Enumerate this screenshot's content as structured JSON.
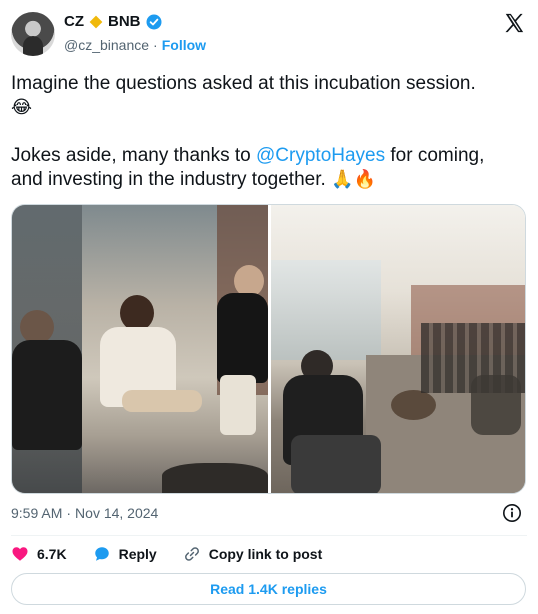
{
  "author": {
    "name": "CZ",
    "bnb_label": "BNB",
    "handle": "@cz_binance",
    "separator": "·",
    "follow_label": "Follow"
  },
  "tweet": {
    "line1": "Imagine the questions asked at this incubation session.",
    "line1_emoji": "😂",
    "line2_before": "Jokes aside, many thanks to ",
    "line2_mention": "@CryptoHayes",
    "line2_after": " for coming, and investing in the industry together. ",
    "line2_emoji": "🙏🔥"
  },
  "meta": {
    "time": "9:59 AM",
    "separator": "·",
    "date": "Nov 14, 2024"
  },
  "actions": {
    "likes": "6.7K",
    "reply_label": "Reply",
    "copy_label": "Copy link to post"
  },
  "read_replies_label": "Read 1.4K replies",
  "colors": {
    "accent": "#1d9bf0",
    "like": "#f91880",
    "bnb": "#f0b90b",
    "muted": "#536471"
  },
  "icons": [
    "bnb-icon",
    "verified-icon",
    "x-logo-icon",
    "info-icon",
    "heart-icon",
    "reply-icon",
    "link-icon"
  ]
}
